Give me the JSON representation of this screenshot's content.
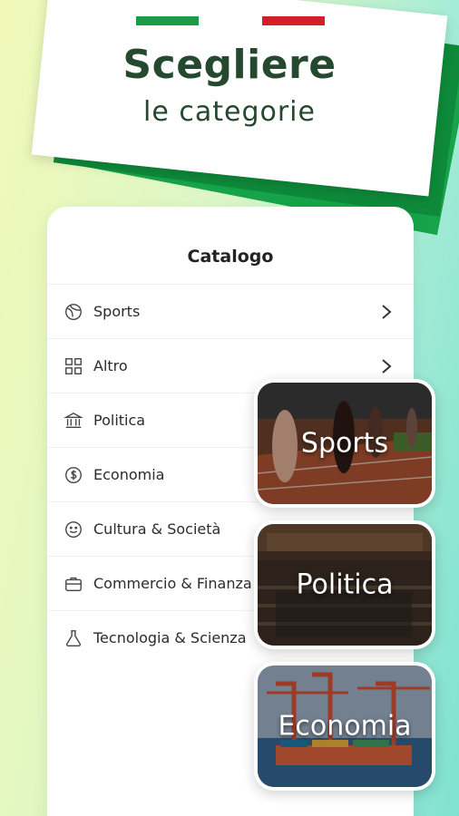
{
  "header": {
    "title": "Scegliere",
    "subtitle": "le categorie",
    "flag_colors": [
      "#1c9a44",
      "#ffffff",
      "#d51f26"
    ]
  },
  "catalog": {
    "title": "Catalogo",
    "items": [
      {
        "label": "Sports",
        "icon": "ball-icon"
      },
      {
        "label": "Altro",
        "icon": "grid-icon"
      },
      {
        "label": "Politica",
        "icon": "government-building-icon"
      },
      {
        "label": "Economia",
        "icon": "dollar-coin-icon"
      },
      {
        "label": "Cultura & Società",
        "icon": "smiley-icon"
      },
      {
        "label": "Commercio & Finanza",
        "icon": "briefcase-icon"
      },
      {
        "label": "Tecnologia & Scienza",
        "icon": "flask-icon"
      }
    ]
  },
  "tiles": [
    {
      "label": "Sports"
    },
    {
      "label": "Politica"
    },
    {
      "label": "Economia"
    }
  ]
}
